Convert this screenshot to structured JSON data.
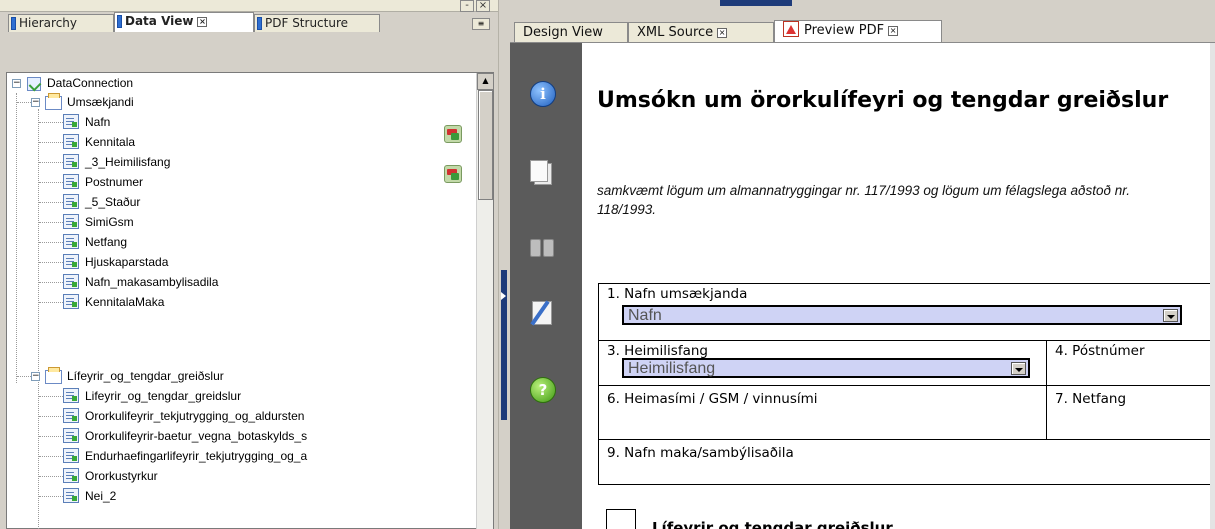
{
  "left_panel": {
    "tabs": [
      {
        "label": "Hierarchy"
      },
      {
        "label": "Data View"
      },
      {
        "label": "PDF Structure"
      }
    ],
    "tree": {
      "root": "DataConnection",
      "groups": [
        {
          "label": "Umsækjandi",
          "fields": [
            "Nafn",
            "Kennitala",
            "_3_Heimilisfang",
            "Postnumer",
            "_5_Staður",
            "SimiGsm",
            "Netfang",
            "Hjuskaparstada",
            "Nafn_makasambylisadila",
            "KennitalaMaka"
          ]
        },
        {
          "label": "Lífeyrir_og_tengdar_greiðslur",
          "fields": [
            "Lifeyrir_og_tengdar_greidslur",
            "Ororkulifeyrir_tekjutrygging_og_aldursten",
            "Ororkulifeyrir-baetur_vegna_botaskylds_s",
            "Endurhaefingarlifeyrir_tekjutrygging_og_a",
            "Ororkustyrkur",
            "Nei_2"
          ]
        }
      ],
      "bound_fields": [
        "Nafn",
        "_3_Heimilisfang"
      ]
    }
  },
  "right_panel": {
    "tabs": [
      {
        "label": "Design View"
      },
      {
        "label": "XML Source"
      },
      {
        "label": "Preview PDF"
      }
    ],
    "pdf_sidebar_icons": [
      "info-icon",
      "pages-icon",
      "binoculars-icon",
      "sign-icon",
      "help-icon"
    ],
    "form": {
      "title": "Umsókn um örorkulífeyri og tengdar greiðslur",
      "subtitle": "samkvæmt  lögum um almannatryggingar nr. 117/1993 og lögum um félagslega aðstoð nr. 118/1993.",
      "fields": {
        "f1": {
          "label": "1. Nafn umsækjanda",
          "value": "Nafn"
        },
        "f3": {
          "label": "3. Heimilisfang",
          "value": "Heimilisfang"
        },
        "f4": {
          "label": "4. Póstnúmer"
        },
        "f6": {
          "label": "6. Heimasími / GSM / vinnusími"
        },
        "f7": {
          "label": "7. Netfang"
        },
        "f9": {
          "label": "9. Nafn maka/sambýlisaðila"
        }
      },
      "section_label": "Lífeyrir og tengdar greiðslur"
    }
  },
  "colors": {
    "field_highlight": "#cfd3f5",
    "sidebar": "#5b5b5b",
    "accent": "#1e3b7a"
  }
}
